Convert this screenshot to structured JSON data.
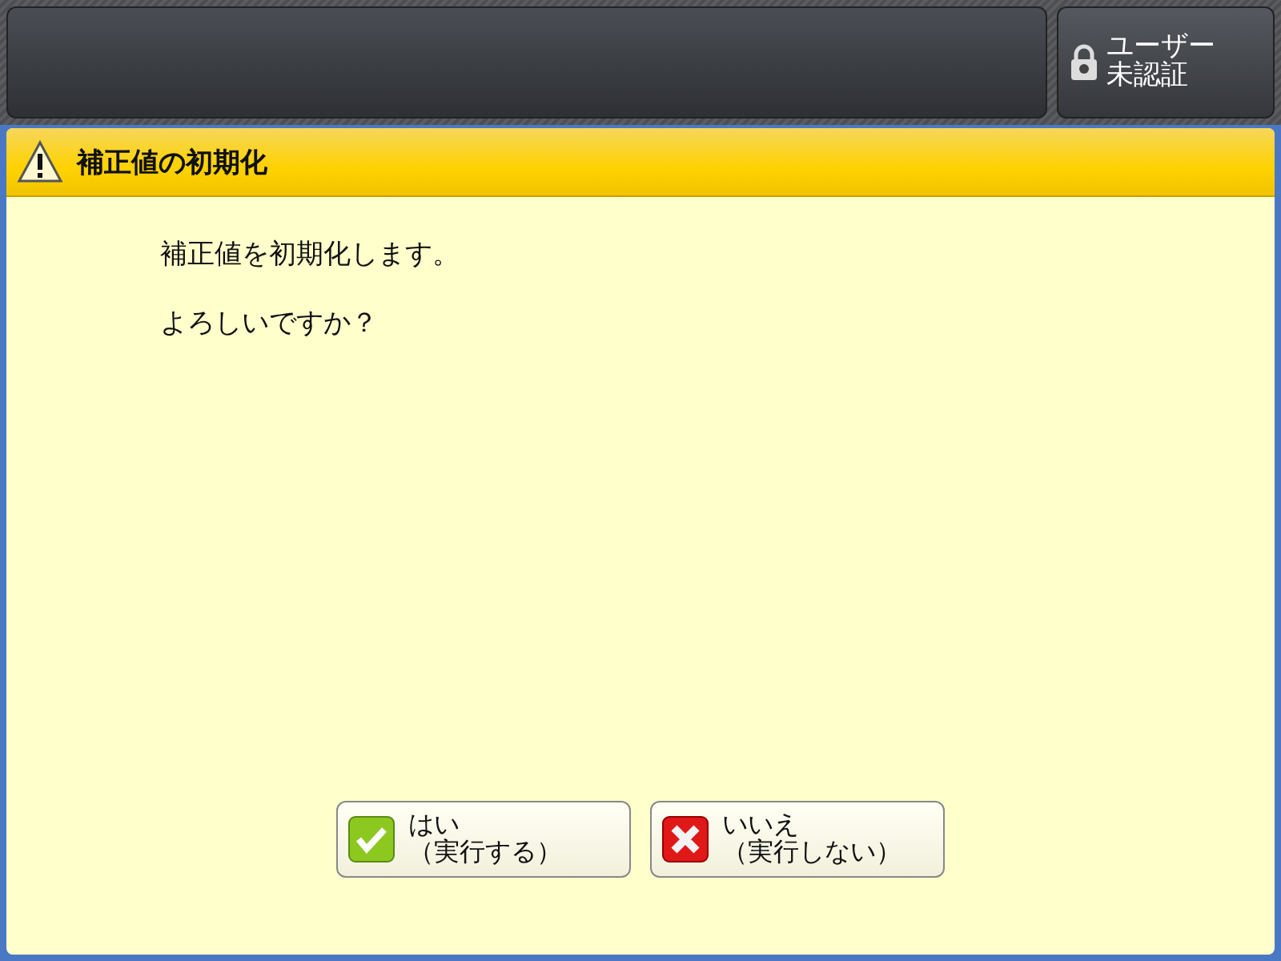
{
  "top_bar": {
    "user_button": {
      "lines": [
        "ユーザー",
        "未認証"
      ]
    }
  },
  "dialog": {
    "title": "補正値の初期化",
    "messages": [
      "補正値を初期化します。",
      "よろしいですか？"
    ],
    "buttons": [
      {
        "kind": "confirm",
        "label": "はい",
        "sublabel": "（実行する）"
      },
      {
        "kind": "cancel",
        "label": "いいえ",
        "sublabel": "（実行しない）"
      }
    ]
  }
}
